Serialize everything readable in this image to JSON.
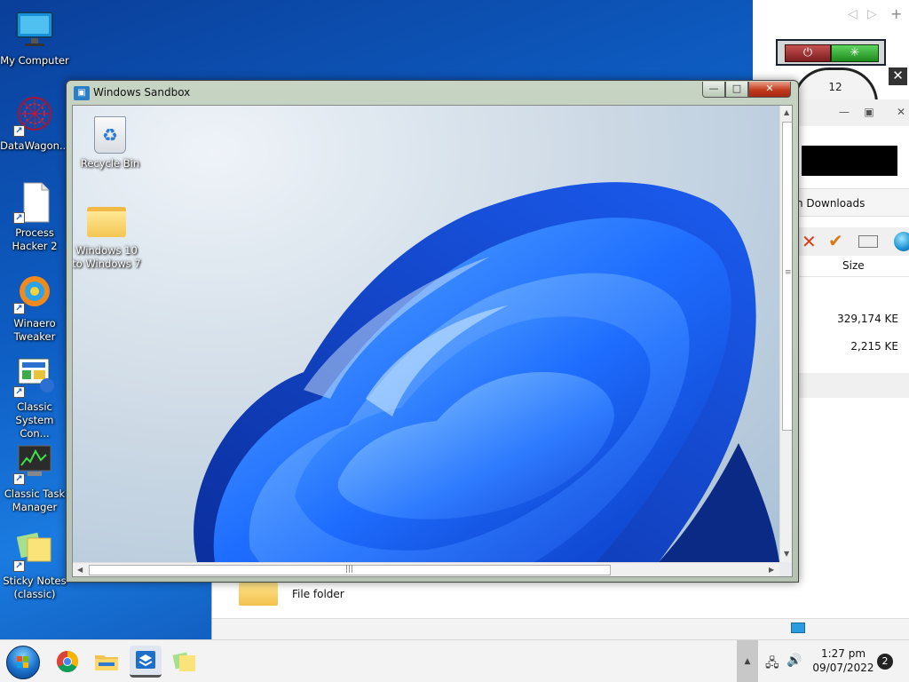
{
  "desktop": {
    "icons": [
      {
        "label": "My Computer"
      },
      {
        "label": "DataWagon..."
      },
      {
        "label": "Process Hacker 2"
      },
      {
        "label": "Winaero Tweaker"
      },
      {
        "label": "Classic System Con..."
      },
      {
        "label": "Classic Task Manager"
      },
      {
        "label": "Sticky Notes (classic)"
      }
    ]
  },
  "sandbox_window": {
    "title": "Windows Sandbox",
    "minimize": "—",
    "maximize": "□",
    "close": "✕",
    "icons": [
      {
        "label": "Recycle Bin"
      },
      {
        "label": "Windows 10 to Windows 7"
      }
    ]
  },
  "background_explorer": {
    "breadcrumb": "h Downloads",
    "size_header": "Size",
    "rows": [
      {
        "size": "329,174 KE"
      },
      {
        "size": "2,215 KE"
      }
    ],
    "lower_item_label": "File folder"
  },
  "taskbar": {
    "time": "1:27 pm",
    "date": "09/07/2022",
    "notification_count": "2",
    "show_hidden_icon": "▲"
  },
  "colors": {
    "desktop_blue": "#1b7be0",
    "sandbox_frame": "#c7d3c3",
    "close_red": "#c23a1c",
    "win11_bloom_blue": "#1f6dff"
  }
}
